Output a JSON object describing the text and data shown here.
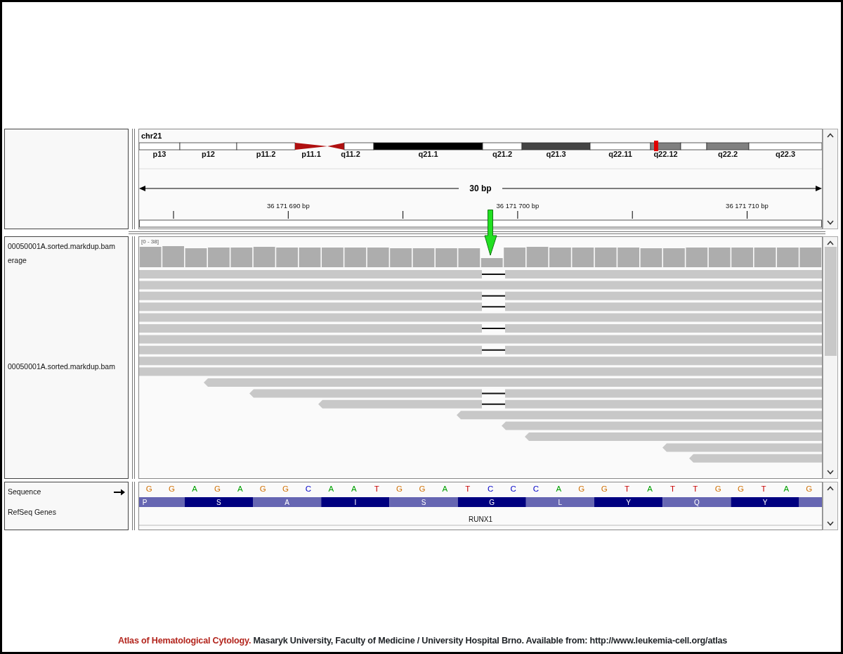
{
  "top_panel": {
    "chromosome": "chr21",
    "bands": [
      {
        "label": "p13",
        "kind": "gneg",
        "in_view": false
      },
      {
        "label": "p12",
        "kind": "gneg",
        "in_view": false
      },
      {
        "label": "p11.2",
        "kind": "gneg",
        "in_view": false
      },
      {
        "label": "p11.1",
        "kind": "acenp",
        "in_view": false
      },
      {
        "label": "q11.2",
        "kind": "acenq",
        "in_view": false
      },
      {
        "label": "q21.1",
        "kind": "gpos100",
        "in_view": false
      },
      {
        "label": "q21.2",
        "kind": "gneg",
        "in_view": false
      },
      {
        "label": "q21.3",
        "kind": "gpos75",
        "in_view": false
      },
      {
        "label": "q22.11",
        "kind": "gneg",
        "in_view": false
      },
      {
        "label": "q22.12",
        "kind": "gpos50",
        "in_view": true
      },
      {
        "kind": "gneg",
        "in_view": false
      },
      {
        "label": "q22.2",
        "kind": "gpos50",
        "in_view": false
      },
      {
        "label": "q22.3",
        "kind": "gneg",
        "in_view": false
      }
    ],
    "span": "30 bp",
    "tick_labels": [
      "36 171 690 bp",
      "36 171 700 bp",
      "36 171 710 bp"
    ]
  },
  "alignment_panel": {
    "track_names": [
      "00050001A.sorted.markdup.bam",
      "erage",
      "00050001A.sorted.markdup.bam"
    ],
    "coverage_range": "[0 - 38]"
  },
  "feature_panel": {
    "sequence_label": "Sequence",
    "strand_arrow": {
      "kind": "forward"
    },
    "genes_label": "RefSeq Genes",
    "bases": [
      "G",
      "G",
      "A",
      "G",
      "A",
      "G",
      "G",
      "C",
      "A",
      "A",
      "T",
      "G",
      "G",
      "A",
      "T",
      "C",
      "C",
      "C",
      "A",
      "G",
      "G",
      "T",
      "A",
      "T",
      "T",
      "G",
      "G",
      "T",
      "A",
      "G"
    ],
    "amino_acids": [
      "P",
      "S",
      "A",
      "I",
      "S",
      "G",
      "L",
      "Y",
      "Q",
      "Y"
    ],
    "gene": "RUNX1"
  },
  "caption": {
    "title": "Atlas of Hematological Cytology.",
    "text": "Masaryk University, Faculty of Medicine / University Hospital Brno. Available from: http://www.leukemia-cell.org/atlas"
  }
}
